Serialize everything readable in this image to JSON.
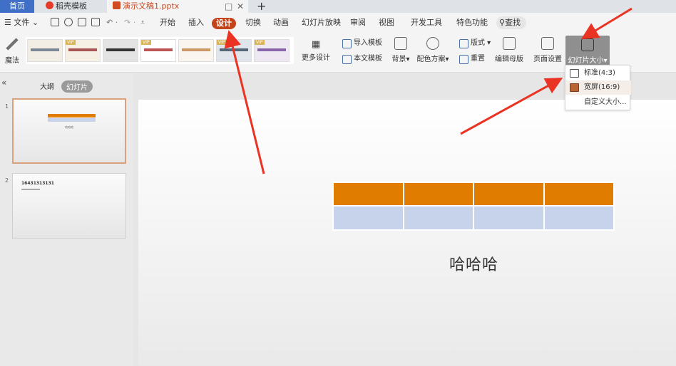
{
  "tabs": {
    "home": "首页",
    "template": "稻壳模板",
    "document": "演示文稿1.pptx"
  },
  "menu": {
    "file": "文件",
    "items": [
      "开始",
      "插入",
      "设计",
      "切换",
      "动画",
      "幻灯片放映",
      "审阅",
      "视图",
      "开发工具",
      "特色功能"
    ],
    "search": "查找"
  },
  "ribbon": {
    "magic": "魔法",
    "more_design": "更多设计",
    "import_template": "导入模板",
    "this_template": "本文模板",
    "background": "背景",
    "color_scheme": "配色方案",
    "layout": "版式",
    "reset": "重置",
    "edit_master": "编辑母版",
    "page_setup": "页面设置",
    "slide_size": "幻灯片大小"
  },
  "dropdown": {
    "standard": "标准(4:3)",
    "widescreen": "宽屏(16:9)",
    "custom": "自定义大小..."
  },
  "left_panel": {
    "outline_tab": "大纲",
    "slides_tab": "幻灯片",
    "slide1_caption": "哈哈哈",
    "slide2_title": "16431313131"
  },
  "slide": {
    "text": "哈哈哈",
    "table_header_color": "#e07c00",
    "table_row_color": "#c6d3ea"
  },
  "colors": {
    "accent": "#c4431a",
    "arrow": "#ea3323"
  }
}
